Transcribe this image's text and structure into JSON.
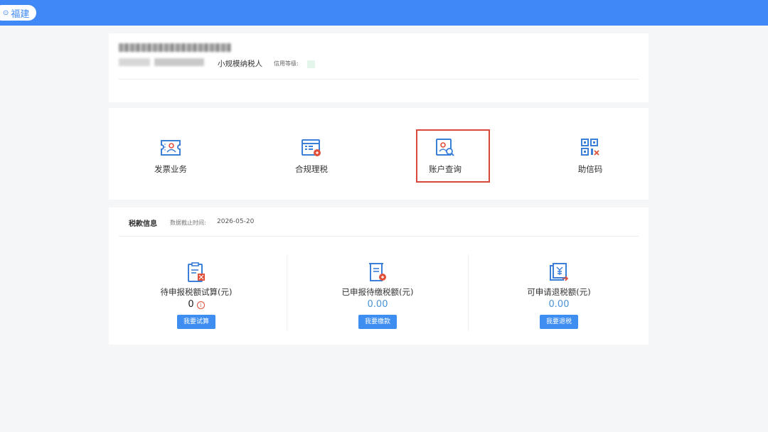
{
  "header": {
    "region_label": "福建",
    "accent_color": "#3f88f5"
  },
  "profile": {
    "taxpayer_type": "小规模纳税人",
    "credit_label": "信用等级:"
  },
  "services": [
    {
      "label": "发票业务",
      "icon": "invoice-ticket-icon"
    },
    {
      "label": "合规理税",
      "icon": "compliance-calendar-icon"
    },
    {
      "label": "账户查询",
      "icon": "account-search-icon"
    },
    {
      "label": "助信码",
      "icon": "qr-code-icon"
    }
  ],
  "highlight_color": "#d9483b",
  "tax_info": {
    "title": "税款信息",
    "cutoff_label": "数据截止时间:",
    "cutoff_date": "2026-05-20",
    "items": [
      {
        "name": "待申报税额试算(元)",
        "amount": "0",
        "button": "我要试算",
        "icon": "clipboard-calc-icon"
      },
      {
        "name": "已申报待缴税额(元)",
        "amount": "0.00",
        "button": "我要缴款",
        "icon": "document-pay-icon"
      },
      {
        "name": "可申请退税额(元)",
        "amount": "0.00",
        "button": "我要退税",
        "icon": "refund-yuan-icon"
      }
    ]
  }
}
